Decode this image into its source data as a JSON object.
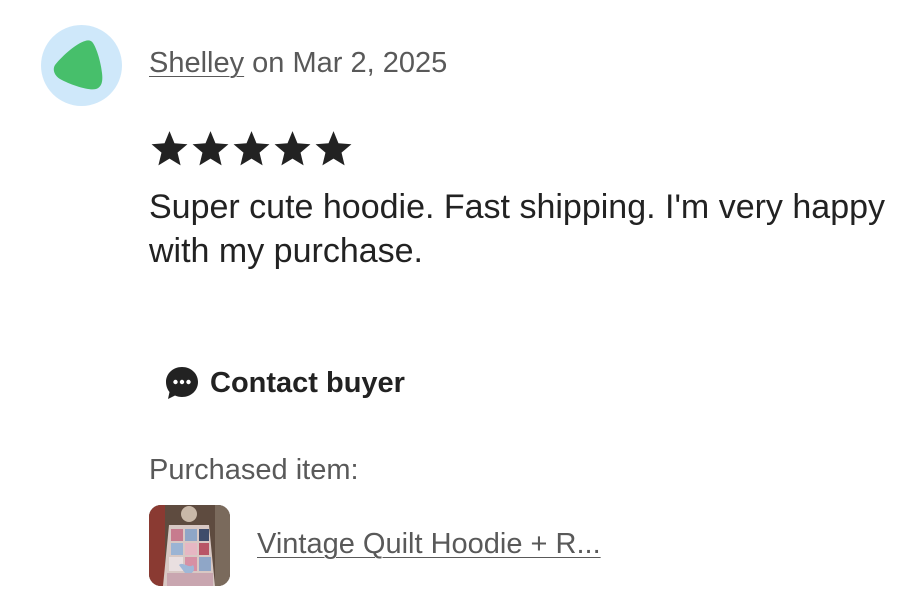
{
  "review": {
    "reviewer_name": "Shelley",
    "date_text": " on Mar 2, 2025",
    "rating": 5,
    "rating_max": 5,
    "text": "Super cute hoodie. Fast shipping. I'm very happy with my purchase.",
    "avatar_icon": "green-leaf-shape-icon"
  },
  "contact": {
    "label": "Contact buyer",
    "icon": "chat-bubble-icon"
  },
  "purchased": {
    "label": "Purchased item:",
    "item_title": "Vintage Quilt Hoodie + R..."
  },
  "colors": {
    "avatar_bg": "#cfe8fa",
    "avatar_shape": "#47bf6b",
    "text_primary": "#222222",
    "text_secondary": "#595959"
  }
}
